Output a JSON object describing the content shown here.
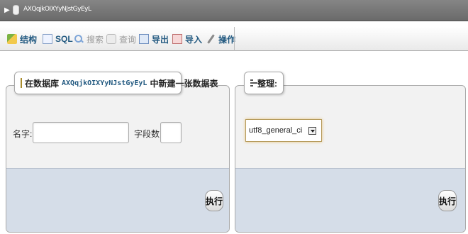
{
  "header": {
    "db_title": "AXQqjkOIXYyNJstGyEyL"
  },
  "tabs": [
    {
      "label": "结构",
      "icon": "structure-icon",
      "enabled": true
    },
    {
      "label": "SQL",
      "icon": "sql-icon",
      "enabled": true
    },
    {
      "label": "搜索",
      "icon": "search-icon",
      "enabled": false
    },
    {
      "label": "查询",
      "icon": "query-icon",
      "enabled": false
    },
    {
      "label": "导出",
      "icon": "export-icon",
      "enabled": true
    },
    {
      "label": "导入",
      "icon": "import-icon",
      "enabled": true
    },
    {
      "label": "操作",
      "icon": "operations-icon",
      "enabled": true
    }
  ],
  "create_table": {
    "legend_prefix": "在数据库",
    "db_name": "AXQqjkOIXYyNJstGyEyL",
    "legend_suffix": "中新建一张数据表",
    "name_label": "名字:",
    "name_value": "",
    "columns_label": "字段数:",
    "columns_value": "",
    "execute_label": "执行"
  },
  "collation": {
    "legend": "整理:",
    "selected": "utf8_general_ci",
    "execute_label": "执行"
  },
  "colors": {
    "link": "#235a81",
    "footer": "#d5dde8",
    "topbar": "#7a7a7a"
  }
}
